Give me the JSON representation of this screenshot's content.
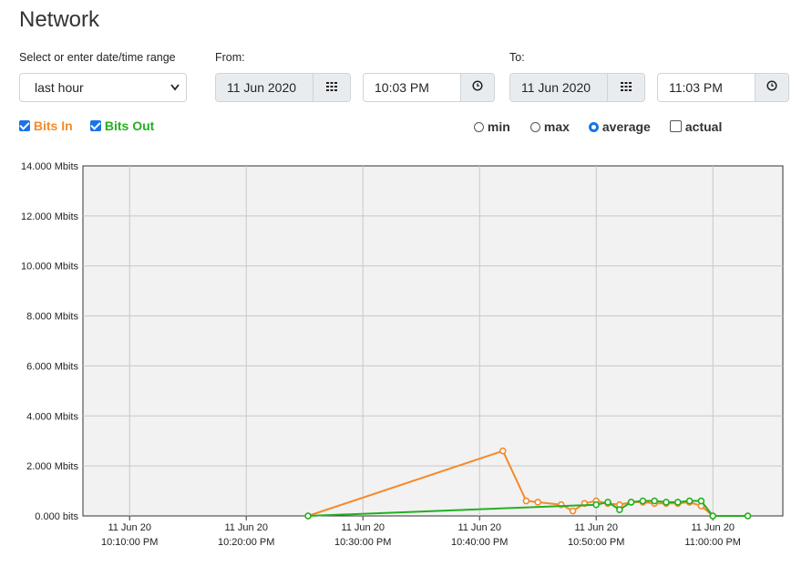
{
  "page": {
    "title": "Network"
  },
  "range": {
    "label": "Select or enter date/time range",
    "value": "last hour"
  },
  "from": {
    "label": "From:",
    "date": "11 Jun 2020",
    "time": "10:03 PM"
  },
  "to": {
    "label": "To:",
    "date": "11 Jun 2020",
    "time": "11:03 PM"
  },
  "legend": {
    "bits_in": {
      "label": "Bits In",
      "checked": true,
      "color": "#f5892a"
    },
    "bits_out": {
      "label": "Bits Out",
      "checked": true,
      "color": "#22b022"
    }
  },
  "modes": [
    {
      "label": "min",
      "selected": false
    },
    {
      "label": "max",
      "selected": false
    },
    {
      "label": "average",
      "selected": true
    }
  ],
  "actual": {
    "label": "actual",
    "checked": false
  },
  "icons": {
    "calendar": "calendar-grid-icon",
    "clock": "clock-icon",
    "dropdown": "chevron-down-icon"
  },
  "chart_data": {
    "type": "line",
    "x_range": [
      "22:03",
      "23:03"
    ],
    "ylim": [
      0,
      14
    ],
    "y_unit": "Mbits",
    "y_ticks": [
      "0.000 bits",
      "2.000 Mbits",
      "4.000 Mbits",
      "6.000 Mbits",
      "8.000 Mbits",
      "10.000 Mbits",
      "12.000 Mbits",
      "14.000 Mbits"
    ],
    "x_ticks": [
      {
        "date": "11 Jun 20",
        "time": "10:10:00 PM",
        "t": 7
      },
      {
        "date": "11 Jun 20",
        "time": "10:20:00 PM",
        "t": 17
      },
      {
        "date": "11 Jun 20",
        "time": "10:30:00 PM",
        "t": 27
      },
      {
        "date": "11 Jun 20",
        "time": "10:40:00 PM",
        "t": 37
      },
      {
        "date": "11 Jun 20",
        "time": "10:50:00 PM",
        "t": 47
      },
      {
        "date": "11 Jun 20",
        "time": "11:00:00 PM",
        "t": 57
      }
    ],
    "grid": true,
    "series": [
      {
        "name": "Bits In",
        "color": "#f5892a",
        "points": [
          [
            22.3,
            0
          ],
          [
            39.0,
            2.6
          ],
          [
            41.0,
            0.6
          ],
          [
            42.0,
            0.55
          ],
          [
            44.0,
            0.45
          ],
          [
            45.0,
            0.2
          ],
          [
            46.0,
            0.5
          ],
          [
            47.0,
            0.6
          ],
          [
            48.0,
            0.5
          ],
          [
            49.0,
            0.45
          ],
          [
            50.0,
            0.55
          ],
          [
            51.0,
            0.55
          ],
          [
            52.0,
            0.5
          ],
          [
            53.0,
            0.5
          ],
          [
            54.0,
            0.5
          ],
          [
            55.0,
            0.55
          ],
          [
            56.0,
            0.4
          ],
          [
            57.0,
            0.0
          ],
          [
            60.0,
            0.0
          ]
        ]
      },
      {
        "name": "Bits Out",
        "color": "#22b022",
        "points": [
          [
            22.3,
            0
          ],
          [
            47.0,
            0.45
          ],
          [
            48.0,
            0.55
          ],
          [
            49.0,
            0.25
          ],
          [
            50.0,
            0.55
          ],
          [
            51.0,
            0.6
          ],
          [
            52.0,
            0.6
          ],
          [
            53.0,
            0.55
          ],
          [
            54.0,
            0.55
          ],
          [
            55.0,
            0.6
          ],
          [
            56.0,
            0.6
          ],
          [
            57.0,
            0.0
          ],
          [
            60.0,
            0.0
          ]
        ]
      }
    ]
  }
}
